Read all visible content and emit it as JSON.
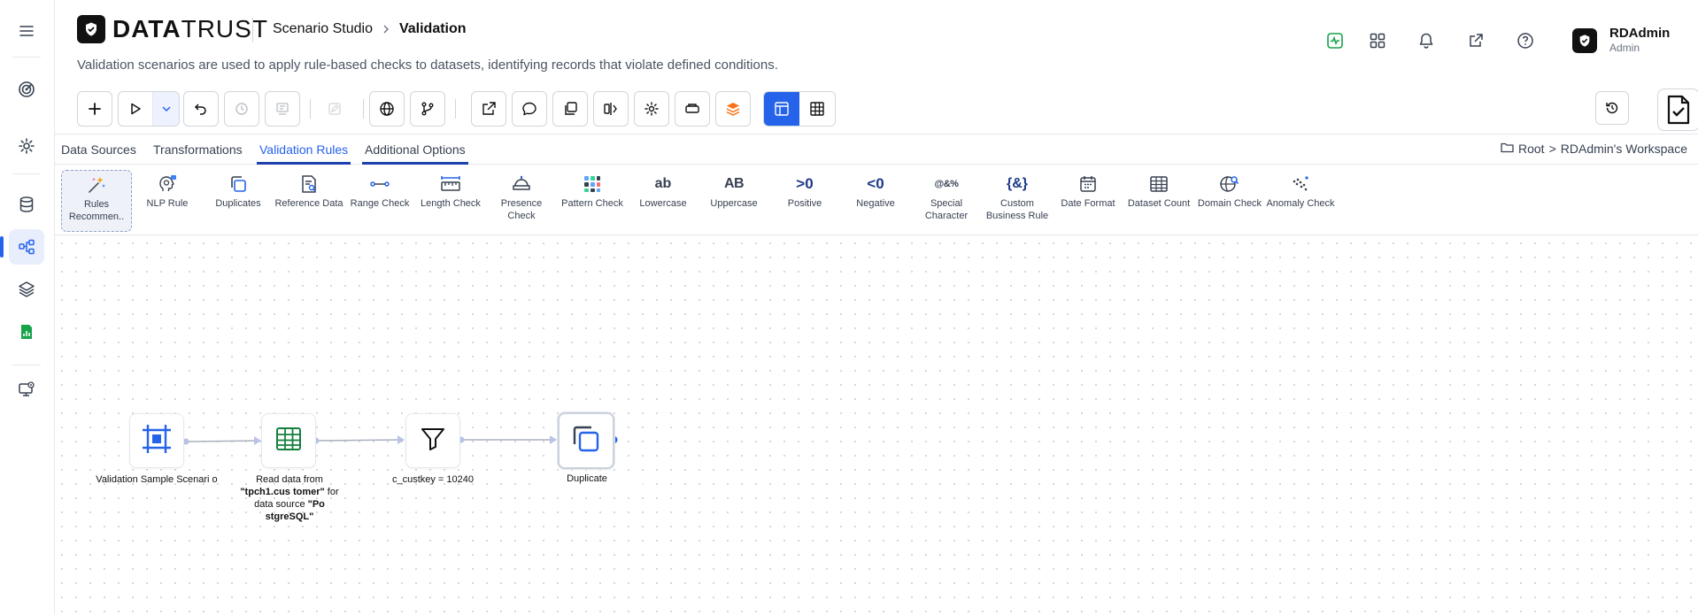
{
  "app": {
    "logo_bold": "DATA",
    "logo_light": "TRUST",
    "breadcrumb": [
      "Scenario Studio",
      "Validation"
    ],
    "subtitle": "Validation scenarios are used to apply rule-based checks to datasets, identifying records that violate defined conditions."
  },
  "user": {
    "name": "RDAdmin",
    "role": "Admin"
  },
  "tabs": [
    {
      "label": "Data Sources"
    },
    {
      "label": "Transformations"
    },
    {
      "label": "Validation Rules"
    },
    {
      "label": "Additional Options"
    }
  ],
  "workspace": {
    "root": "Root",
    "separator": ">",
    "name": "RDAdmin's Workspace"
  },
  "palette": [
    {
      "label": "Rules Recommen..",
      "icon": "sparkles-icon"
    },
    {
      "label": "NLP Rule",
      "icon": "brain-gear-icon"
    },
    {
      "label": "Duplicates",
      "icon": "duplicate-icon"
    },
    {
      "label": "Reference Data",
      "icon": "reference-doc-icon"
    },
    {
      "label": "Range Check",
      "icon": "range-icon"
    },
    {
      "label": "Length Check",
      "icon": "ruler-icon"
    },
    {
      "label": "Presence Check",
      "icon": "bell-tray-icon"
    },
    {
      "label": "Pattern Check",
      "icon": "pattern-grid-icon"
    },
    {
      "label": "Lowercase",
      "icon": "lowercase-icon",
      "glyph": "ab"
    },
    {
      "label": "Uppercase",
      "icon": "uppercase-icon",
      "glyph": "AB"
    },
    {
      "label": "Positive",
      "icon": "positive-icon",
      "glyph": ">0"
    },
    {
      "label": "Negative",
      "icon": "negative-icon",
      "glyph": "<0"
    },
    {
      "label": "Special Character",
      "icon": "special-char-icon",
      "glyph": "@&%"
    },
    {
      "label": "Custom Business Rule",
      "icon": "braces-icon",
      "glyph": "{&}"
    },
    {
      "label": "Date Format",
      "icon": "calendar-icon"
    },
    {
      "label": "Dataset Count",
      "icon": "table-count-icon"
    },
    {
      "label": "Domain Check",
      "icon": "globe-search-icon"
    },
    {
      "label": "Anomaly Check",
      "icon": "scatter-icon"
    }
  ],
  "flow": {
    "nodes": [
      {
        "id": "scenario",
        "icon": "scenario-frame-icon",
        "label": "Validation Sample Scenari o"
      },
      {
        "id": "source",
        "icon": "table-icon",
        "label_pre": "Read data from ",
        "label_table": "\"tpch1.cus tomer\"",
        "label_mid": " for data source ",
        "label_db": "\"Po stgreSQL\""
      },
      {
        "id": "filter",
        "icon": "filter-icon",
        "label": "c_custkey = 10240"
      },
      {
        "id": "duplicate",
        "icon": "duplicate-icon",
        "label": "Duplicate"
      }
    ]
  },
  "colors": {
    "accent": "#2563eb",
    "dark": "#111111",
    "green": "#16a34a",
    "orange": "#f97316"
  }
}
